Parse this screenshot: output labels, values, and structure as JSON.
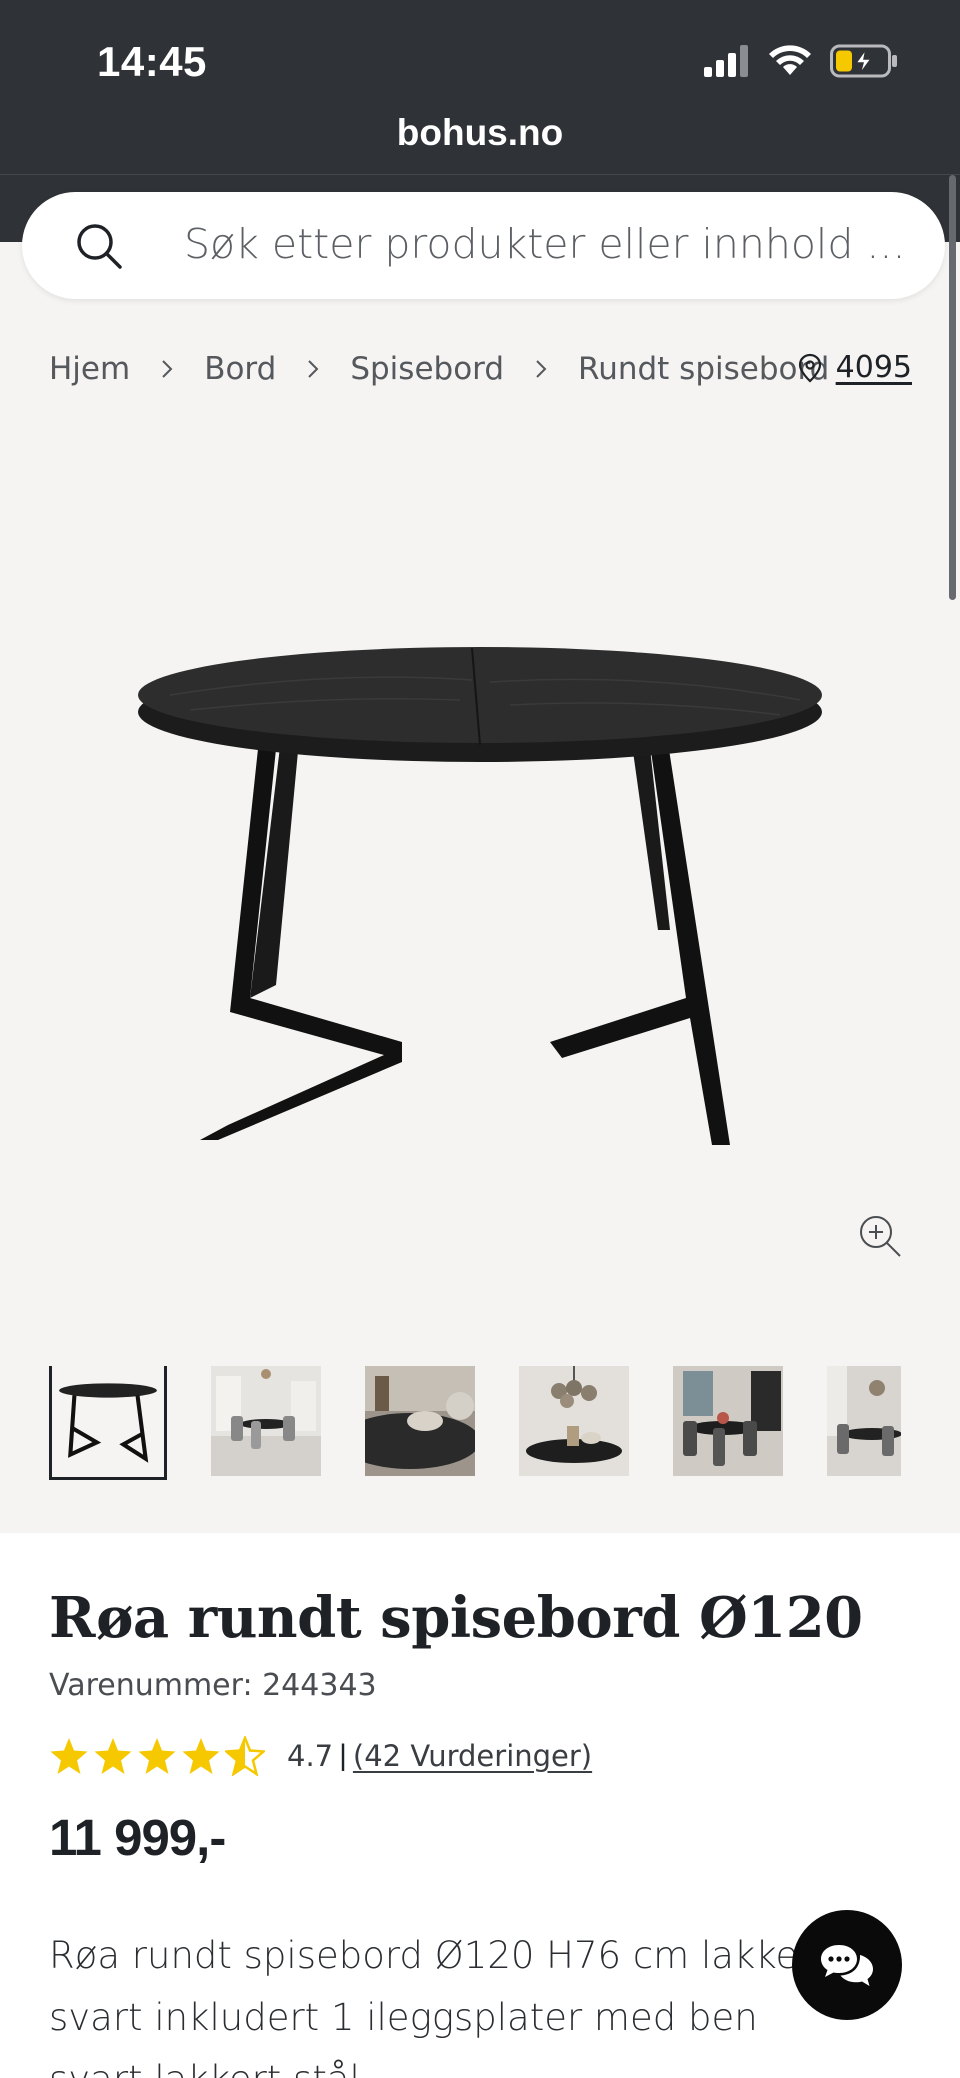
{
  "status_bar": {
    "time": "14:45"
  },
  "browser": {
    "url": "bohus.no"
  },
  "search": {
    "placeholder": "Søk etter produkter eller innhold ..."
  },
  "breadcrumb": [
    {
      "label": "Hjem"
    },
    {
      "label": "Bord"
    },
    {
      "label": "Spisebord"
    },
    {
      "label": "Rundt spisebord"
    }
  ],
  "store": {
    "number": "4095"
  },
  "product": {
    "title": "Røa rundt spisebord Ø120",
    "sku_label": "Varenummer: 244343",
    "rating_value": "4.7",
    "rating_separator": "|",
    "rating_count": "(42 Vurderinger)",
    "rating_stars": 4.5,
    "price": "11 999,-",
    "description": "Røa rundt spisebord Ø120 H76 cm lakkert svart inkludert 1 ileggsplater med ben svart lakkert stål"
  },
  "thumbnails": [
    {
      "alt": "table-thumbnail"
    },
    {
      "alt": "dining-room-thumbnail"
    },
    {
      "alt": "table-closeup-thumbnail"
    },
    {
      "alt": "table-with-lamp-thumbnail"
    },
    {
      "alt": "room-setting-thumbnail"
    },
    {
      "alt": "room-setting-thumbnail-2"
    }
  ],
  "colors": {
    "topbar": "#2f3236",
    "background": "#f5f4f2",
    "text": "#1e2226",
    "star": "#f5c800"
  }
}
